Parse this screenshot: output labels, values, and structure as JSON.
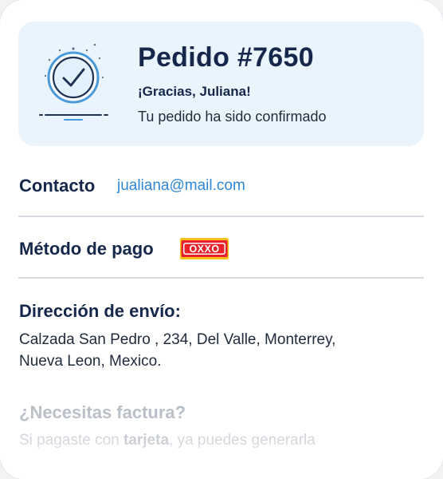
{
  "order": {
    "title": "Pedido #7650",
    "thanks": "¡Gracias, Juliana!",
    "status": "Tu pedido ha sido confirmado",
    "icon": "check-circle-icon"
  },
  "contact": {
    "label": "Contacto",
    "email": "jualiana@mail.com"
  },
  "payment": {
    "label": "Método de pago",
    "method_logo_text": "OXXO",
    "logo_colors": {
      "red": "#e8212b",
      "yellow": "#f6c21b"
    }
  },
  "shipping": {
    "label": "Dirección de envío:",
    "address": "Calzada San Pedro , 234, Del Valle, Monterrey,\nNueva Leon,  Mexico."
  },
  "invoice": {
    "title": "¿Necesitas factura?",
    "text_prefix": "Si pagaste con ",
    "text_bold": "tarjeta",
    "text_suffix": ", ya puedes generarla"
  },
  "colors": {
    "accent": "#2f86d6",
    "heading": "#15274a",
    "card_bg": "#eaf4fc"
  }
}
